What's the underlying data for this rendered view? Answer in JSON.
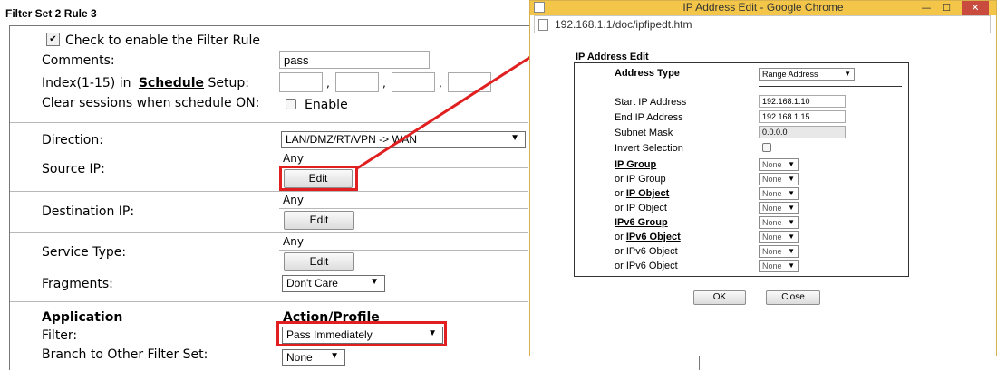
{
  "page_title": "Filter Set 2 Rule 3",
  "enable_checkbox": {
    "label": "Check to enable the Filter Rule",
    "checked_glyph": "✔"
  },
  "comments": {
    "label": "Comments:",
    "value": "pass"
  },
  "schedule": {
    "prefix": "Index(1-15) in",
    "link": "Schedule",
    "suffix": "Setup:",
    "separator": ","
  },
  "clear_sessions": {
    "label": "Clear sessions when schedule ON:",
    "option": "Enable"
  },
  "direction": {
    "label": "Direction:",
    "value": "LAN/DMZ/RT/VPN -> WAN"
  },
  "source_ip": {
    "label": "Source IP:",
    "value": "Any",
    "button": "Edit"
  },
  "destination_ip": {
    "label": "Destination IP:",
    "value": "Any",
    "button": "Edit"
  },
  "service_type": {
    "label": "Service Type:",
    "value": "Any",
    "button": "Edit"
  },
  "fragments": {
    "label": "Fragments:",
    "value": "Don't Care"
  },
  "application": {
    "header": "Application",
    "action_header": "Action/Profile"
  },
  "filter": {
    "label": "Filter:",
    "value": "Pass Immediately"
  },
  "branch": {
    "label": "Branch to Other Filter Set:",
    "value": "None"
  },
  "popup": {
    "window_title": "IP Address Edit - Google Chrome",
    "url": "192.168.1.1/doc/ipfipedt.htm",
    "heading": "IP Address Edit",
    "address_type": {
      "label": "Address Type",
      "value": "Range Address"
    },
    "start_ip": {
      "label": "Start IP Address",
      "value": "192.168.1.10"
    },
    "end_ip": {
      "label": "End IP Address",
      "value": "192.168.1.15"
    },
    "subnet_mask": {
      "label": "Subnet Mask",
      "value": "0.0.0.0"
    },
    "invert": {
      "label": "Invert Selection"
    },
    "groups": [
      {
        "label": "IP Group",
        "prefix": "",
        "underlined": true,
        "value": "None"
      },
      {
        "label": "or IP Group",
        "prefix": "",
        "underlined": false,
        "value": "None"
      },
      {
        "label": "IP Object",
        "prefix": "or ",
        "underlined": true,
        "value": "None"
      },
      {
        "label": "or IP Object",
        "prefix": "",
        "underlined": false,
        "value": "None"
      },
      {
        "label": "IPv6 Group",
        "prefix": "",
        "underlined": true,
        "value": "None"
      },
      {
        "label": "IPv6 Object",
        "prefix": "or ",
        "underlined": true,
        "value": "None"
      },
      {
        "label": "or IPv6 Object",
        "prefix": "",
        "underlined": false,
        "value": "None"
      },
      {
        "label": "or IPv6 Object",
        "prefix": "",
        "underlined": false,
        "value": "None"
      }
    ],
    "ok_button": "OK",
    "close_button": "Close"
  },
  "colors": {
    "highlight": "#e02020",
    "popup_titlebar": "#f3c64a"
  }
}
